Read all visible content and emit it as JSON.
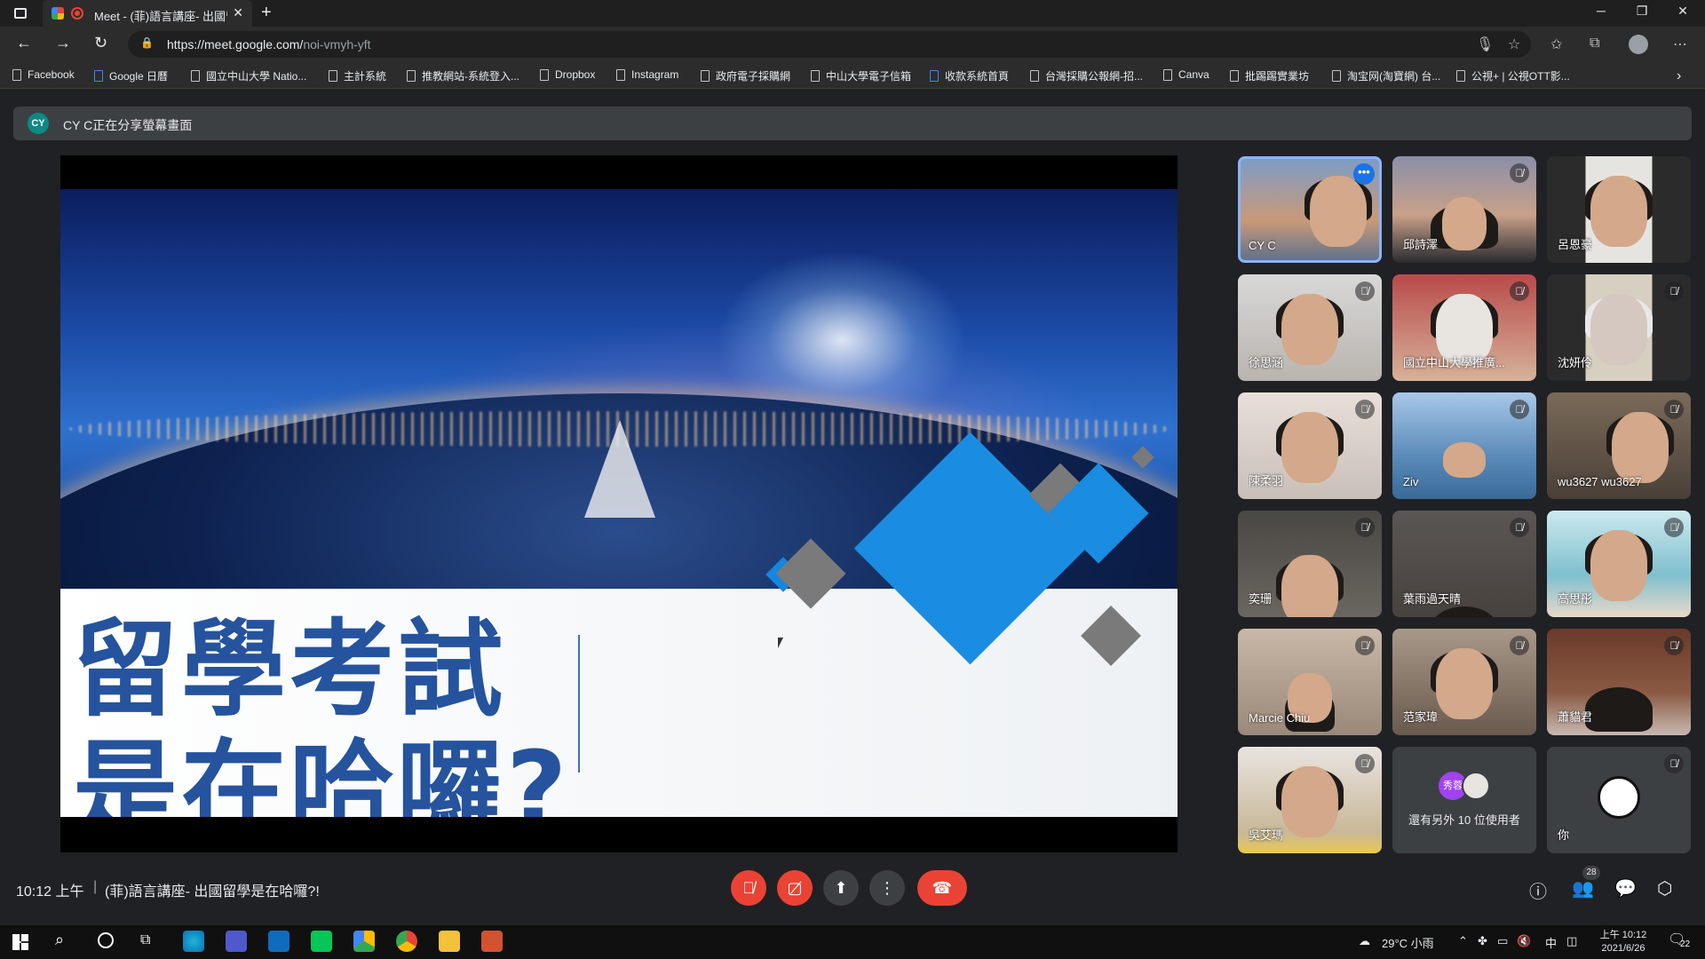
{
  "browser": {
    "tab_title": "Meet - (菲)語言講座- 出國留學是在哈囉?!",
    "url_host": "https://meet.google.com/",
    "url_path": "noi-vmyh-yft",
    "bookmarks": [
      "Facebook",
      "Google 日曆",
      "國立中山大學 Natio...",
      "主計系統",
      "推教網站-系統登入...",
      "Dropbox",
      "Instagram",
      "政府電子採購網",
      "中山大學電子信箱",
      "收款系統首頁",
      "台灣採購公報網-招...",
      "Canva",
      "批踢踢實業坊",
      "淘宝网(淘寶網) 台...",
      "公視+ | 公視OTT影..."
    ]
  },
  "meet": {
    "banner_avatar": "CY",
    "banner_text": "CY C正在分享螢幕畫面",
    "slide": {
      "line1": "留學考試",
      "line2": "是在哈囉?"
    },
    "participants": [
      {
        "name": "CY C",
        "speaking": true
      },
      {
        "name": "邱詩澤",
        "muted": true
      },
      {
        "name": "呂恩豪",
        "muted": false
      },
      {
        "name": "徐思涵",
        "muted": true
      },
      {
        "name": "國立中山大學推廣...",
        "muted": true
      },
      {
        "name": "沈妍伶",
        "muted": true
      },
      {
        "name": "陳柔羽",
        "muted": true
      },
      {
        "name": "Ziv",
        "muted": true
      },
      {
        "name": "wu3627 wu3627",
        "muted": true
      },
      {
        "name": "奕珊",
        "muted": true
      },
      {
        "name": "葉雨過天晴",
        "muted": true
      },
      {
        "name": "高思彤",
        "muted": true
      },
      {
        "name": "Marcie Chiu",
        "muted": true
      },
      {
        "name": "范家瑋",
        "muted": true
      },
      {
        "name": "蕭貓君",
        "muted": true
      },
      {
        "name": "吳艾瑪",
        "muted": true
      },
      {
        "name": "還有另外 10 位使用者",
        "others_avatar": "秀蓉"
      },
      {
        "name": "你",
        "muted": true
      }
    ],
    "time": "10:12 上午",
    "meeting_title": "(菲)語言講座- 出國留學是在哈囉?!",
    "participant_count": "28"
  },
  "taskbar": {
    "weather": "29°C 小雨",
    "ime": "中",
    "clock_time": "上午 10:12",
    "clock_date": "2021/6/26",
    "notifications": "22"
  },
  "colors": {
    "accent": "#8ab4f8",
    "danger": "#ea4335",
    "slide_text": "#25539d"
  }
}
